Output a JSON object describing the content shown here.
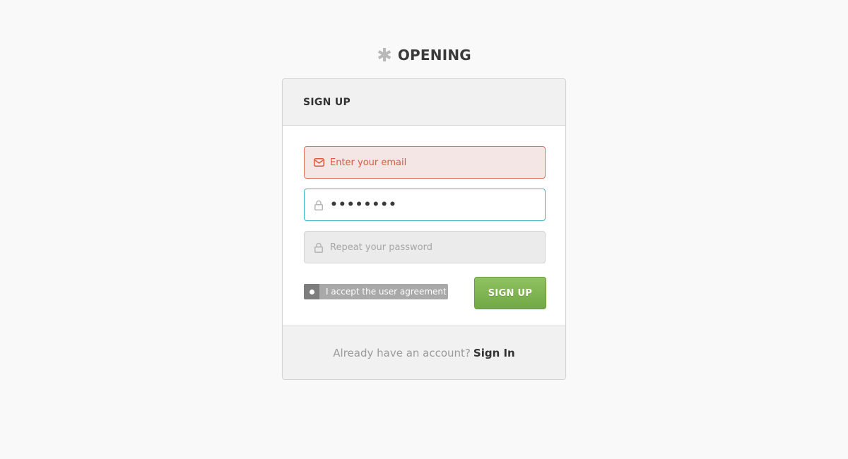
{
  "brand": {
    "name": "OPENING",
    "icon": "asterisk-logo-icon",
    "star_glyph": "✱"
  },
  "card": {
    "title": "SIGN UP"
  },
  "form": {
    "email": {
      "placeholder": "Enter your email",
      "value": "",
      "state": "error",
      "icon": "envelope-icon",
      "color": "#e0563b"
    },
    "password": {
      "value": "••••••••",
      "state": "focused",
      "icon": "lock-icon",
      "color": "#38b8c6"
    },
    "repeat_password": {
      "placeholder": "Repeat your password",
      "value": "",
      "state": "disabled",
      "icon": "lock-icon"
    },
    "agreement": {
      "label": "I accept the user agreement",
      "checked": false
    },
    "submit_label": "SIGN UP",
    "submit_color": "#7ab34c"
  },
  "footer": {
    "text": "Already have an account?",
    "link_label": "Sign In"
  }
}
